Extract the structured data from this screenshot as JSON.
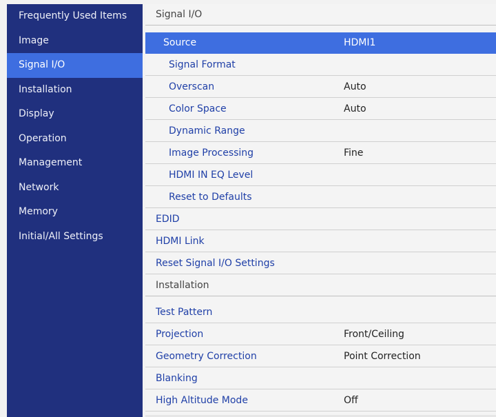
{
  "sidebar": {
    "items": [
      {
        "label": "Frequently Used Items"
      },
      {
        "label": "Image"
      },
      {
        "label": "Signal I/O",
        "active": true
      },
      {
        "label": "Installation"
      },
      {
        "label": "Display"
      },
      {
        "label": "Operation"
      },
      {
        "label": "Management"
      },
      {
        "label": "Network"
      },
      {
        "label": "Memory"
      },
      {
        "label": "Initial/All Settings"
      }
    ]
  },
  "main": {
    "signal_io": {
      "header": "Signal I/O",
      "source": {
        "label": "Source",
        "value": "HDMI1"
      },
      "signal_format": {
        "label": "Signal Format"
      },
      "overscan": {
        "label": "Overscan",
        "value": "Auto"
      },
      "color_space": {
        "label": "Color Space",
        "value": "Auto"
      },
      "dynamic_range": {
        "label": "Dynamic Range"
      },
      "image_processing": {
        "label": "Image Processing",
        "value": "Fine"
      },
      "hdmi_in_eq_level": {
        "label": "HDMI IN EQ Level"
      },
      "reset_to_defaults": {
        "label": "Reset to Defaults"
      },
      "edid": {
        "label": "EDID"
      },
      "hdmi_link": {
        "label": "HDMI Link"
      },
      "reset_signal_io": {
        "label": "Reset Signal I/O Settings"
      }
    },
    "installation": {
      "header": "Installation",
      "test_pattern": {
        "label": "Test Pattern"
      },
      "projection": {
        "label": "Projection",
        "value": "Front/Ceiling"
      },
      "geometry_correction": {
        "label": "Geometry Correction",
        "value": "Point Correction"
      },
      "blanking": {
        "label": "Blanking"
      },
      "high_altitude_mode": {
        "label": "High Altitude Mode",
        "value": "Off"
      }
    }
  },
  "colors": {
    "sidebar_bg": "#20307e",
    "highlight": "#3e6ee0",
    "item_text": "#1f3fa7",
    "panel_bg": "#f4f4f4"
  }
}
